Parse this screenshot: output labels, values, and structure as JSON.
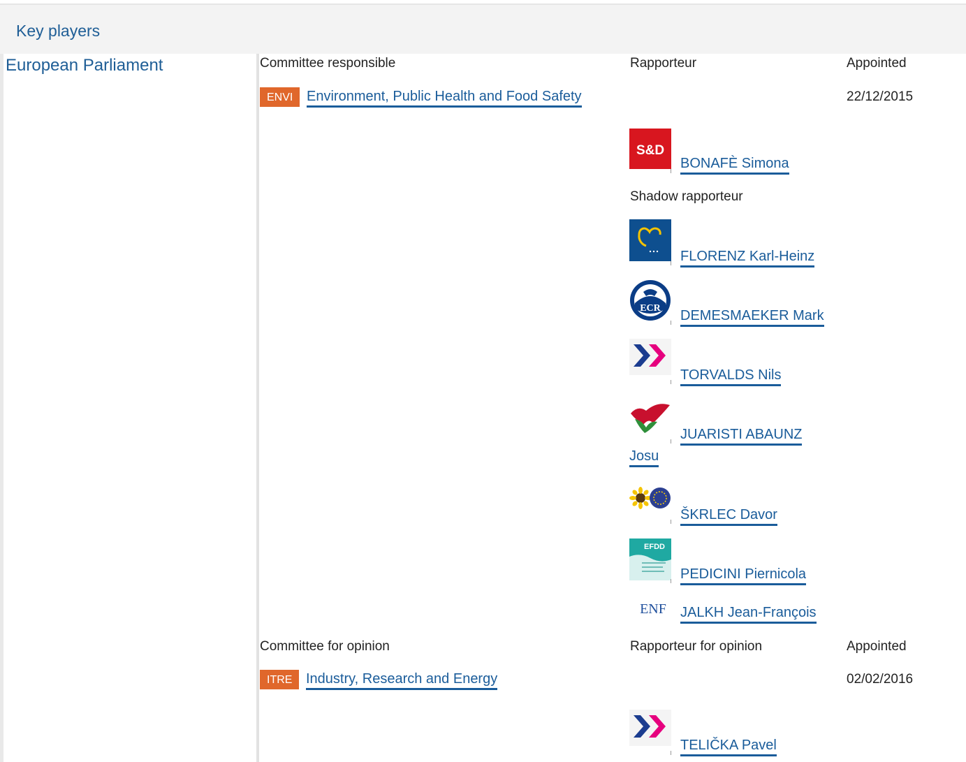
{
  "header": {
    "title": "Key players"
  },
  "institution": "European Parliament",
  "responsible": {
    "label": "Committee responsible",
    "rapporteur_label": "Rapporteur",
    "appointed_label": "Appointed",
    "committee": {
      "code": "ENVI",
      "name": "Environment, Public Health and Food Safety"
    },
    "appointed": "22/12/2015",
    "rapporteur": {
      "name": "BONAFÈ Simona",
      "group_logo": "S&D"
    },
    "shadow_label": "Shadow rapporteur",
    "shadows": [
      {
        "name": "FLORENZ Karl-Heinz",
        "group_icon": "epp-logo-icon"
      },
      {
        "name": "DEMESMAEKER Mark",
        "group_icon": "ecr-logo-icon",
        "logo_text": "ECR"
      },
      {
        "name": "TORVALDS Nils",
        "group_icon": "alde-logo-icon"
      },
      {
        "name_line1": "JUARISTI ABAUNZ",
        "name_line2": "Josu",
        "group_icon": "gue-ngl-logo-icon"
      },
      {
        "name": "ŠKRLEC Davor",
        "group_icon": "greens-efa-logo-icon"
      },
      {
        "name": "PEDICINI Piernicola",
        "group_icon": "efdd-logo-icon",
        "logo_text": "EFDD"
      },
      {
        "name": "JALKH Jean-François",
        "group_icon": "enf-logo-icon",
        "logo_text": "ENF"
      }
    ]
  },
  "opinion": {
    "label": "Committee for opinion",
    "rapporteur_label": "Rapporteur for opinion",
    "appointed_label": "Appointed",
    "committee": {
      "code": "ITRE",
      "name": "Industry, Research and Energy"
    },
    "appointed": "02/02/2016",
    "rapporteur": {
      "name": "TELIČKA Pavel",
      "group_icon": "alde-logo-icon"
    }
  },
  "colors": {
    "link": "#1a5c9a",
    "badge": "#e0672b",
    "heading": "#1f5e96"
  }
}
